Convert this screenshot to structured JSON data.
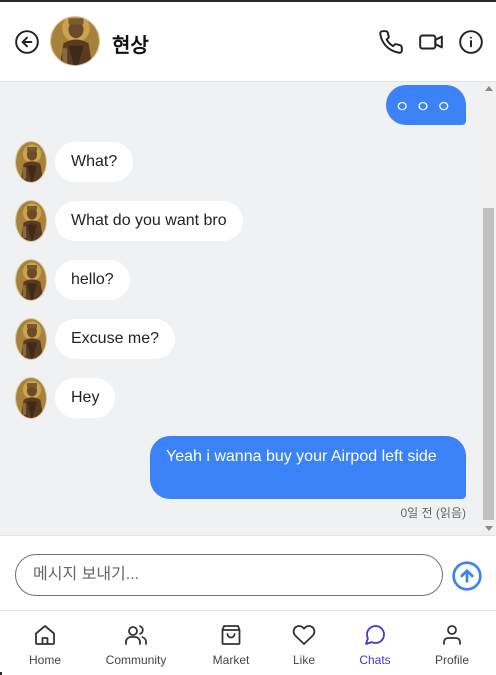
{
  "header": {
    "back_icon": "arrow-left-circle-icon",
    "contact_name": "현상",
    "actions": [
      "phone-icon",
      "video-icon",
      "info-icon"
    ]
  },
  "messages": {
    "typing_indicator": "ㅇㅇㅇ",
    "incoming": [
      {
        "text": "What?"
      },
      {
        "text": "What do you want bro"
      },
      {
        "text": "hello?"
      },
      {
        "text": "Excuse me?"
      },
      {
        "text": "Hey"
      }
    ],
    "outgoing": {
      "text": "Yeah i wanna buy your Airpod left side",
      "timestamp": "0일 전 (읽음)"
    }
  },
  "composer": {
    "placeholder": "메시지 보내기...",
    "value": "",
    "send_icon": "arrow-up-circle-icon"
  },
  "nav": {
    "items": [
      {
        "label": "Home",
        "icon": "home-icon"
      },
      {
        "label": "Community",
        "icon": "users-icon"
      },
      {
        "label": "Market",
        "icon": "shopping-bag-icon"
      },
      {
        "label": "Like",
        "icon": "heart-icon"
      },
      {
        "label": "Chats",
        "icon": "chat-bubble-icon",
        "active": true
      },
      {
        "label": "Profile",
        "icon": "user-icon"
      }
    ]
  },
  "colors": {
    "accent": "#3b82f6",
    "active_nav": "#4338ca",
    "chat_bg": "#f0f1f3"
  }
}
